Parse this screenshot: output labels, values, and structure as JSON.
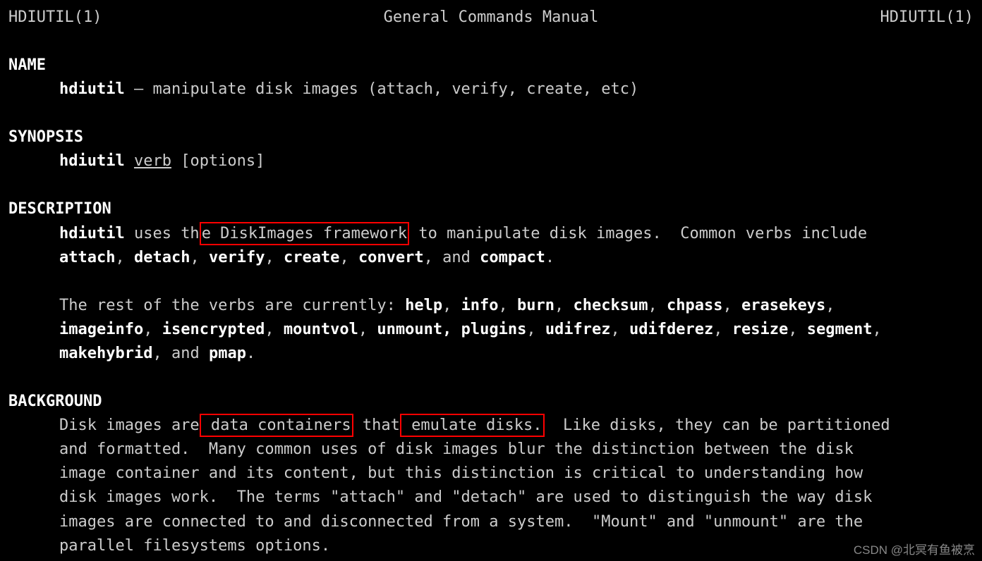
{
  "header": {
    "left": "HDIUTIL(1)",
    "center": "General Commands Manual",
    "right": "HDIUTIL(1)"
  },
  "name_section": {
    "title": "NAME",
    "cmd": "hdiutil",
    "dash": " – ",
    "desc": "manipulate disk images (attach, verify, create, etc)"
  },
  "synopsis_section": {
    "title": "SYNOPSIS",
    "cmd": "hdiutil",
    "verb": "verb",
    "options": " [options]"
  },
  "description_section": {
    "title": "DESCRIPTION",
    "line1_pre": "hdiutil",
    "line1_mid1": " uses th",
    "line1_box": "e DiskImages framework",
    "line1_post": " to manipulate disk images.  Common verbs include",
    "verbs1": [
      "attach",
      "detach",
      "verify",
      "create",
      "convert"
    ],
    "and1": "and",
    "verb_last1": "compact",
    "line3_pre": "The rest of the verbs are currently: ",
    "verbs2a": [
      "help",
      "info",
      "burn",
      "checksum",
      "chpass",
      "erasekeys"
    ],
    "verbs2b": [
      "imageinfo",
      "isencrypted",
      "mountvol",
      "unmount, plugins",
      "udifrez",
      "udifderez",
      "resize",
      "segment"
    ],
    "verbs2c": [
      "makehybrid"
    ],
    "and2": "and",
    "verb_last2": "pmap"
  },
  "background_section": {
    "title": "BACKGROUND",
    "l1_pre": "Disk images are",
    "l1_box1": " data containers",
    "l1_mid": " that",
    "l1_box2": " emulate disks.",
    "l1_post": "  Like disks, they can be partitioned",
    "l2": "and formatted.  Many common uses of disk images blur the distinction between the disk",
    "l3": "image container and its content, but this distinction is critical to understanding how",
    "l4": "disk images work.  The terms \"attach\" and \"detach\" are used to distinguish the way disk",
    "l5": "images are connected to and disconnected from a system.  \"Mount\" and \"unmount\" are the",
    "l6": "parallel filesystems options."
  },
  "watermark": "CSDN @北冥有鱼被烹"
}
